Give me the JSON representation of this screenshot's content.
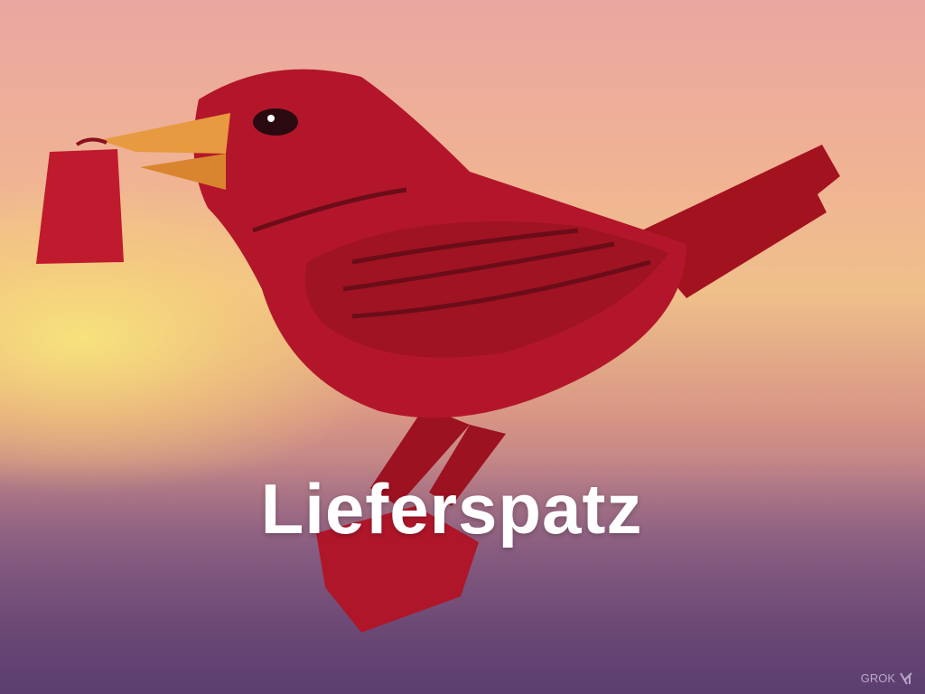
{
  "image": {
    "title": "Lieferspatz",
    "watermark": "GROK",
    "colors": {
      "bird": "#b3162a",
      "beak": "#e89a40",
      "sky_top": "#e9a6a0",
      "sky_glow": "#f7e27c",
      "bottom": "#6a4b78"
    }
  }
}
